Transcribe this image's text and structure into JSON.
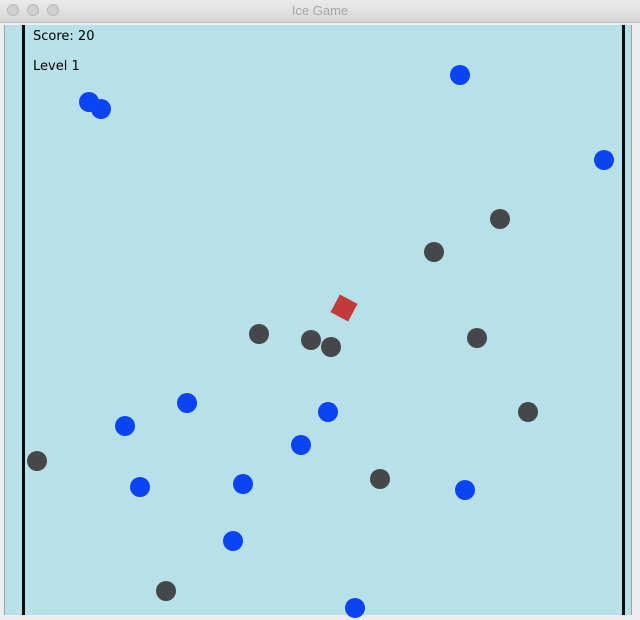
{
  "window": {
    "title": "Ice Game"
  },
  "hud": {
    "score_text": "Score: 20",
    "level_text": "Level 1"
  },
  "colors": {
    "field_background": "#b8e0e8",
    "collectible_ball": "#0a44f5",
    "obstacle_ball": "#454748",
    "player": "#c23a3a",
    "wall": "#0a0a0a"
  }
}
